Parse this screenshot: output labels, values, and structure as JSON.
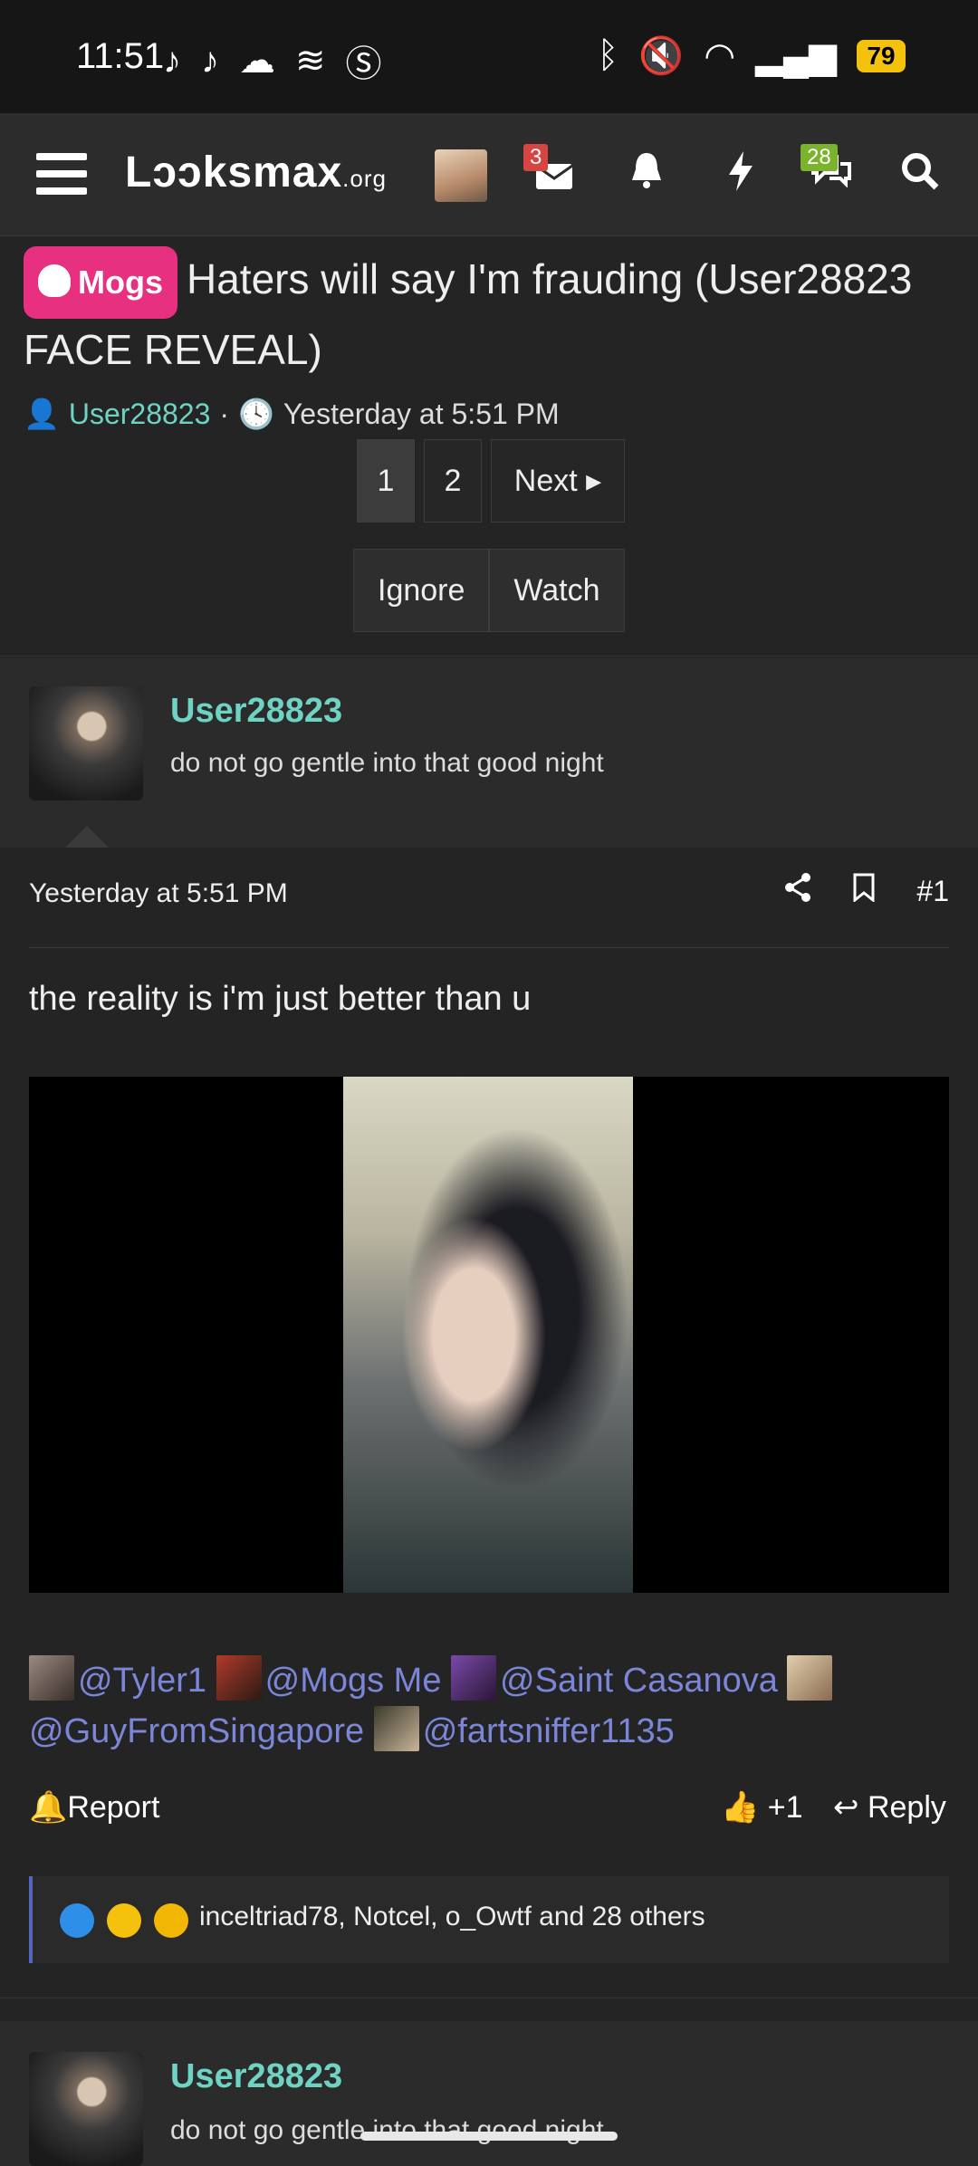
{
  "status": {
    "time": "11:51",
    "battery": "79"
  },
  "nav": {
    "logo_main": "Lɔɔksmax",
    "logo_tld": ".org",
    "inbox_badge": "3",
    "chat_badge": "28"
  },
  "thread": {
    "prefix": "Mogs",
    "title": "Haters will say I'm frauding (User28823 FACE REVEAL)",
    "author": "User28823",
    "date": "Yesterday at 5:51 PM",
    "pages": [
      "1",
      "2"
    ],
    "next": "Next",
    "ignore": "Ignore",
    "watch": "Watch"
  },
  "post": {
    "username": "User28823",
    "user_title": "do not go gentle into that good night",
    "date": "Yesterday at 5:51 PM",
    "number": "#1",
    "text": "the reality is i'm just better than u",
    "mentions": [
      "@Tyler1",
      "@Mogs Me",
      "@Saint Casanova",
      "@GuyFromSingapore",
      "@fartsniffer1135"
    ],
    "report": "Report",
    "plus_one": "+1",
    "reply": "Reply",
    "reactions_text": "inceltriad78, Notcel, o_Owtf and 28 others"
  },
  "post2": {
    "username": "User28823",
    "user_title": "do not go gentle into that good night"
  }
}
